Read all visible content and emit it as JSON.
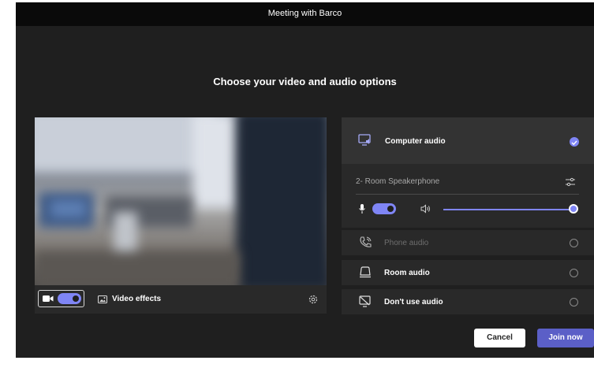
{
  "window": {
    "title": "Meeting with Barco"
  },
  "heading": "Choose your video and audio options",
  "video": {
    "camera_on": true,
    "effects_label": "Video effects",
    "icons": {
      "camera": "camera-icon",
      "effects": "video-effects-icon",
      "settings": "gear-icon"
    }
  },
  "audio": {
    "options": [
      {
        "label": "Computer audio",
        "icon": "computer-audio-icon",
        "selected": true
      },
      {
        "label": "Phone audio",
        "icon": "phone-audio-icon",
        "selected": false,
        "disabled": true
      },
      {
        "label": "Room audio",
        "icon": "room-audio-icon",
        "selected": false
      },
      {
        "label": "Don't use audio",
        "icon": "no-audio-icon",
        "selected": false
      }
    ],
    "device": "2- Room Speakerphone",
    "mic_on": true,
    "volume_fraction": 1.0
  },
  "buttons": {
    "cancel": "Cancel",
    "join": "Join now"
  },
  "colors": {
    "accent": "#7f85f5",
    "primary_button": "#5b5fc7",
    "background": "#1f1f1f",
    "panel": "#292929",
    "titlebar": "#0a0a0a"
  }
}
